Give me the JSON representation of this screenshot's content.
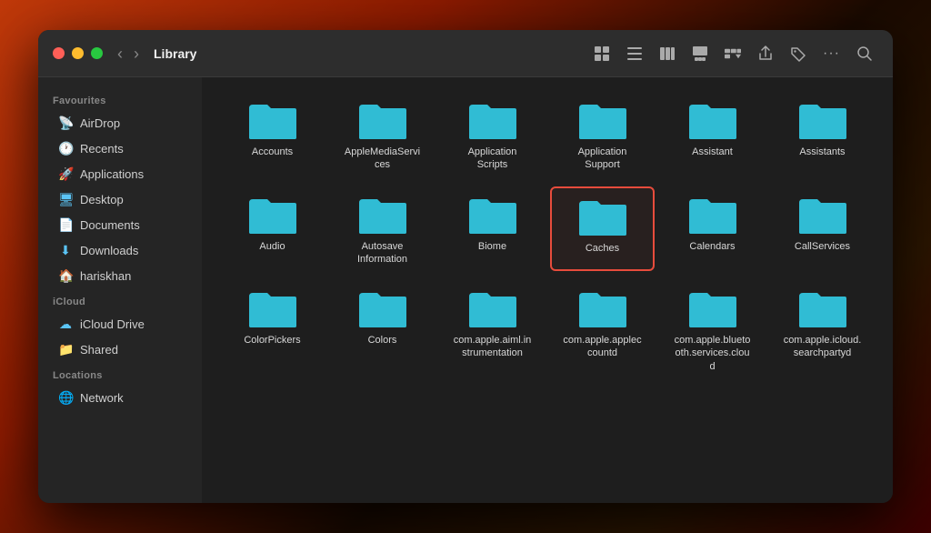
{
  "window": {
    "title": "Library"
  },
  "titlebar": {
    "close_label": "",
    "minimize_label": "",
    "maximize_label": "",
    "back_label": "‹",
    "forward_label": "›"
  },
  "toolbar": {
    "view_grid": "⊞",
    "view_list": "≡",
    "view_columns": "⊟",
    "view_gallery": "⊡",
    "view_more": "⊞",
    "share": "↑",
    "tag": "◇",
    "more": "···",
    "search": "⌕"
  },
  "sidebar": {
    "favourites_label": "Favourites",
    "icloud_label": "iCloud",
    "locations_label": "Locations",
    "items": [
      {
        "id": "airdrop",
        "label": "AirDrop",
        "icon": "airdrop"
      },
      {
        "id": "recents",
        "label": "Recents",
        "icon": "recents"
      },
      {
        "id": "applications",
        "label": "Applications",
        "icon": "apps"
      },
      {
        "id": "desktop",
        "label": "Desktop",
        "icon": "desktop"
      },
      {
        "id": "documents",
        "label": "Documents",
        "icon": "docs"
      },
      {
        "id": "downloads",
        "label": "Downloads",
        "icon": "downloads"
      },
      {
        "id": "hariskhan",
        "label": "hariskhan",
        "icon": "home"
      }
    ],
    "icloud_items": [
      {
        "id": "icloud-drive",
        "label": "iCloud Drive",
        "icon": "icloud"
      },
      {
        "id": "shared",
        "label": "Shared",
        "icon": "shared"
      }
    ],
    "location_items": [
      {
        "id": "network",
        "label": "Network",
        "icon": "network"
      }
    ]
  },
  "folders": [
    {
      "id": "accounts",
      "name": "Accounts",
      "selected": false
    },
    {
      "id": "applemediaservices",
      "name": "AppleMediaServices",
      "selected": false
    },
    {
      "id": "application-scripts",
      "name": "Application Scripts",
      "selected": false
    },
    {
      "id": "application-support",
      "name": "Application Support",
      "selected": false
    },
    {
      "id": "assistant",
      "name": "Assistant",
      "selected": false
    },
    {
      "id": "assistants",
      "name": "Assistants",
      "selected": false
    },
    {
      "id": "audio",
      "name": "Audio",
      "selected": false
    },
    {
      "id": "autosave-information",
      "name": "Autosave Information",
      "selected": false
    },
    {
      "id": "biome",
      "name": "Biome",
      "selected": false
    },
    {
      "id": "caches",
      "name": "Caches",
      "selected": true
    },
    {
      "id": "calendars",
      "name": "Calendars",
      "selected": false
    },
    {
      "id": "callservices",
      "name": "CallServices",
      "selected": false
    },
    {
      "id": "colorpickers",
      "name": "ColorPickers",
      "selected": false
    },
    {
      "id": "colors",
      "name": "Colors",
      "selected": false
    },
    {
      "id": "com-apple-aiml",
      "name": "com.apple.aiml.instrumentation",
      "selected": false
    },
    {
      "id": "com-apple-appleccountd",
      "name": "com.apple.appleccountd",
      "selected": false
    },
    {
      "id": "com-apple-bluetooth",
      "name": "com.apple.bluetooth.services.cloud",
      "selected": false
    },
    {
      "id": "com-apple-icloud",
      "name": "com.apple.icloud.searchpartyd",
      "selected": false
    },
    {
      "id": "folder-row4-1",
      "name": "",
      "selected": false
    },
    {
      "id": "folder-row4-2",
      "name": "",
      "selected": false
    },
    {
      "id": "folder-row4-3",
      "name": "",
      "selected": false
    },
    {
      "id": "folder-row4-4",
      "name": "",
      "selected": false
    }
  ]
}
